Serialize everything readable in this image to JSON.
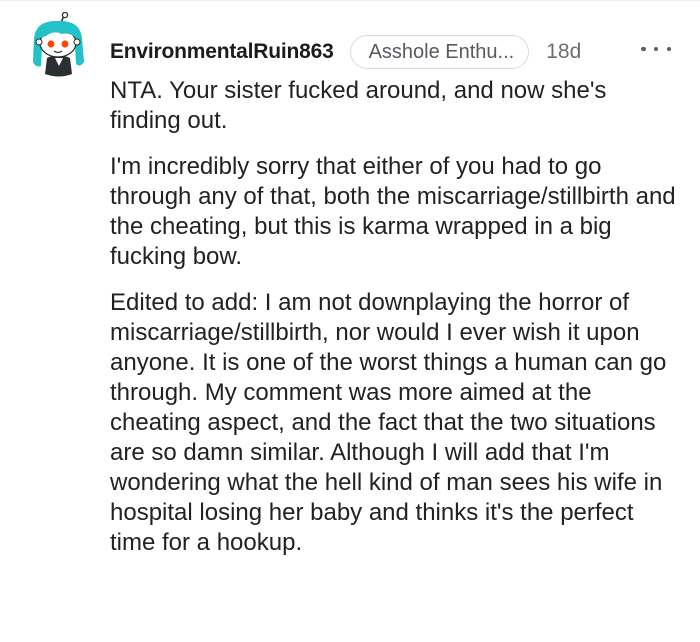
{
  "comment": {
    "author": "EnvironmentalRuin863",
    "flair": "Asshole Enthu...",
    "age": "18d",
    "paragraphs": [
      "NTA. Your sister fucked around, and now she's finding out.",
      "I'm incredibly sorry that either of you had to go through any of that, both the miscarriage/stillbirth and the cheating, but this is karma wrapped in a big fucking bow.",
      "Edited to add: I am not downplaying the horror of miscarriage/stillbirth, nor would I ever wish it upon anyone. It is one of the worst things a human can go through. My comment was more aimed at the cheating aspect, and the fact that the two situations are so damn similar. Although I will add that I'm wondering what the hell kind of man sees his wife in hospital losing her baby and thinks it's the perfect time for a hookup."
    ]
  },
  "icons": {
    "avatar": "snoo-avatar-teal-hair",
    "more": "more-options-icon"
  },
  "colors": {
    "avatar_hair": "#23c1c8",
    "avatar_face": "#ffffff",
    "avatar_eyes": "#ff4500"
  }
}
